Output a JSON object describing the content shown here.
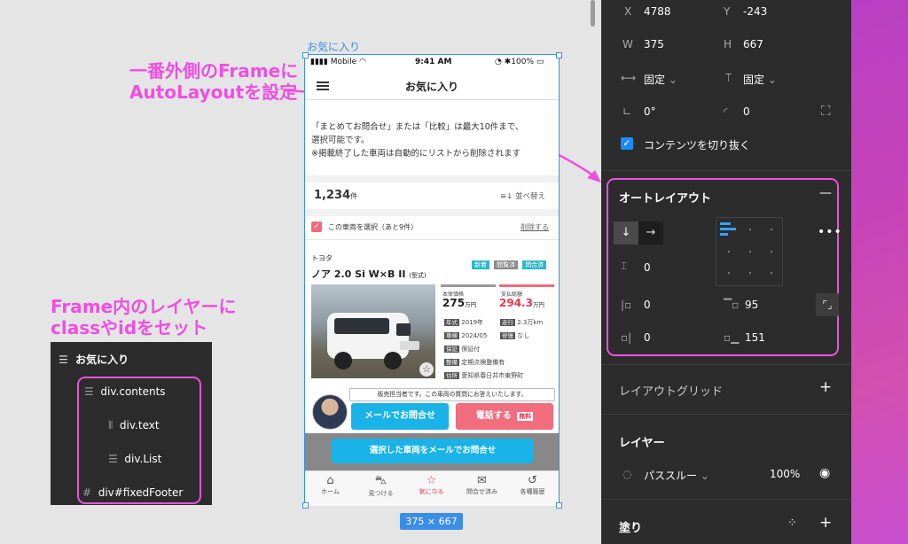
{
  "canvas": {
    "frame_label": "お気に入り",
    "size_badge": "375 × 667",
    "annotation_top": [
      "一番外側のFrameに",
      "AutoLayoutを設定"
    ],
    "annotation_left": [
      "Frame内のレイヤーに",
      "classやidをセット"
    ]
  },
  "phone": {
    "status": {
      "carrier": "Mobile",
      "time": "9:41 AM",
      "battery": "100%"
    },
    "header_title": "お気に入り",
    "notice_lines": [
      "「まとめてお問合せ」または「比較」は最大10件まで、",
      "選択可能です。",
      "※掲載終了した車両は自動的にリストから削除されます"
    ],
    "count": "1,234",
    "count_unit": "件",
    "sort_label": "並べ替え",
    "select_label": "この車両を選択（あと9件）",
    "delete_label": "削除する",
    "car": {
      "maker": "トヨタ",
      "tags": [
        "新着",
        "閲覧済",
        "問合済"
      ],
      "model": "ノア 2.0 Si W×B II",
      "model_suffix": "(型式)",
      "base_price_label": "本体価格",
      "base_price": "275",
      "base_price_unit": "万円",
      "total_price_label": "支払総額",
      "total_price": "294.3",
      "total_price_unit": "万円",
      "specs": [
        {
          "k": "年式",
          "v": "2019年"
        },
        {
          "k": "走行",
          "v": "2.3万km"
        },
        {
          "k": "車検",
          "v": "2024/05"
        },
        {
          "k": "修復",
          "v": "なし"
        },
        {
          "k": "保証",
          "v": "保証付"
        },
        {
          "k": "整備",
          "v": "定期点検整備有"
        },
        {
          "k": "住所",
          "v": "愛知県春日井市東野町"
        }
      ],
      "staff_bubble": "販売担当者です。この車両の質問にお答えいたします。",
      "mail_button": "メールでお問合せ",
      "phone_button": "電話する",
      "free_badge": "無料"
    },
    "fixed_footer_button": "選択した車両をメールでお問合せ",
    "tabs": [
      "ホーム",
      "見つける",
      "気になる",
      "問合せ済み",
      "各種履歴"
    ]
  },
  "layers": {
    "root": "お気に入り",
    "items": [
      "div.contents",
      "div.text",
      "div.List",
      "div#fixedFooter"
    ]
  },
  "panel": {
    "x_label": "X",
    "x": "4788",
    "y_label": "Y",
    "y": "-243",
    "w_label": "W",
    "w": "375",
    "h_label": "H",
    "h": "667",
    "h_constraint": "固定",
    "v_constraint": "固定",
    "rotation": "0°",
    "radius": "0",
    "clip_label": "コンテンツを切り抜く",
    "autolayout_title": "オートレイアウト",
    "spacing": "0",
    "pad_left": "0",
    "pad_top": "95",
    "pad_right": "0",
    "pad_bottom": "151",
    "layout_grid": "レイアウトグリッド",
    "layer_title": "レイヤー",
    "blend": "パススルー",
    "opacity": "100%",
    "fill_title": "塗り"
  },
  "colors": {
    "accent": "#ee4fe2",
    "selection": "#3a8ee6",
    "cyan": "#00b4e6",
    "pink": "#f06b7e",
    "panel": "#2c2c2c"
  }
}
